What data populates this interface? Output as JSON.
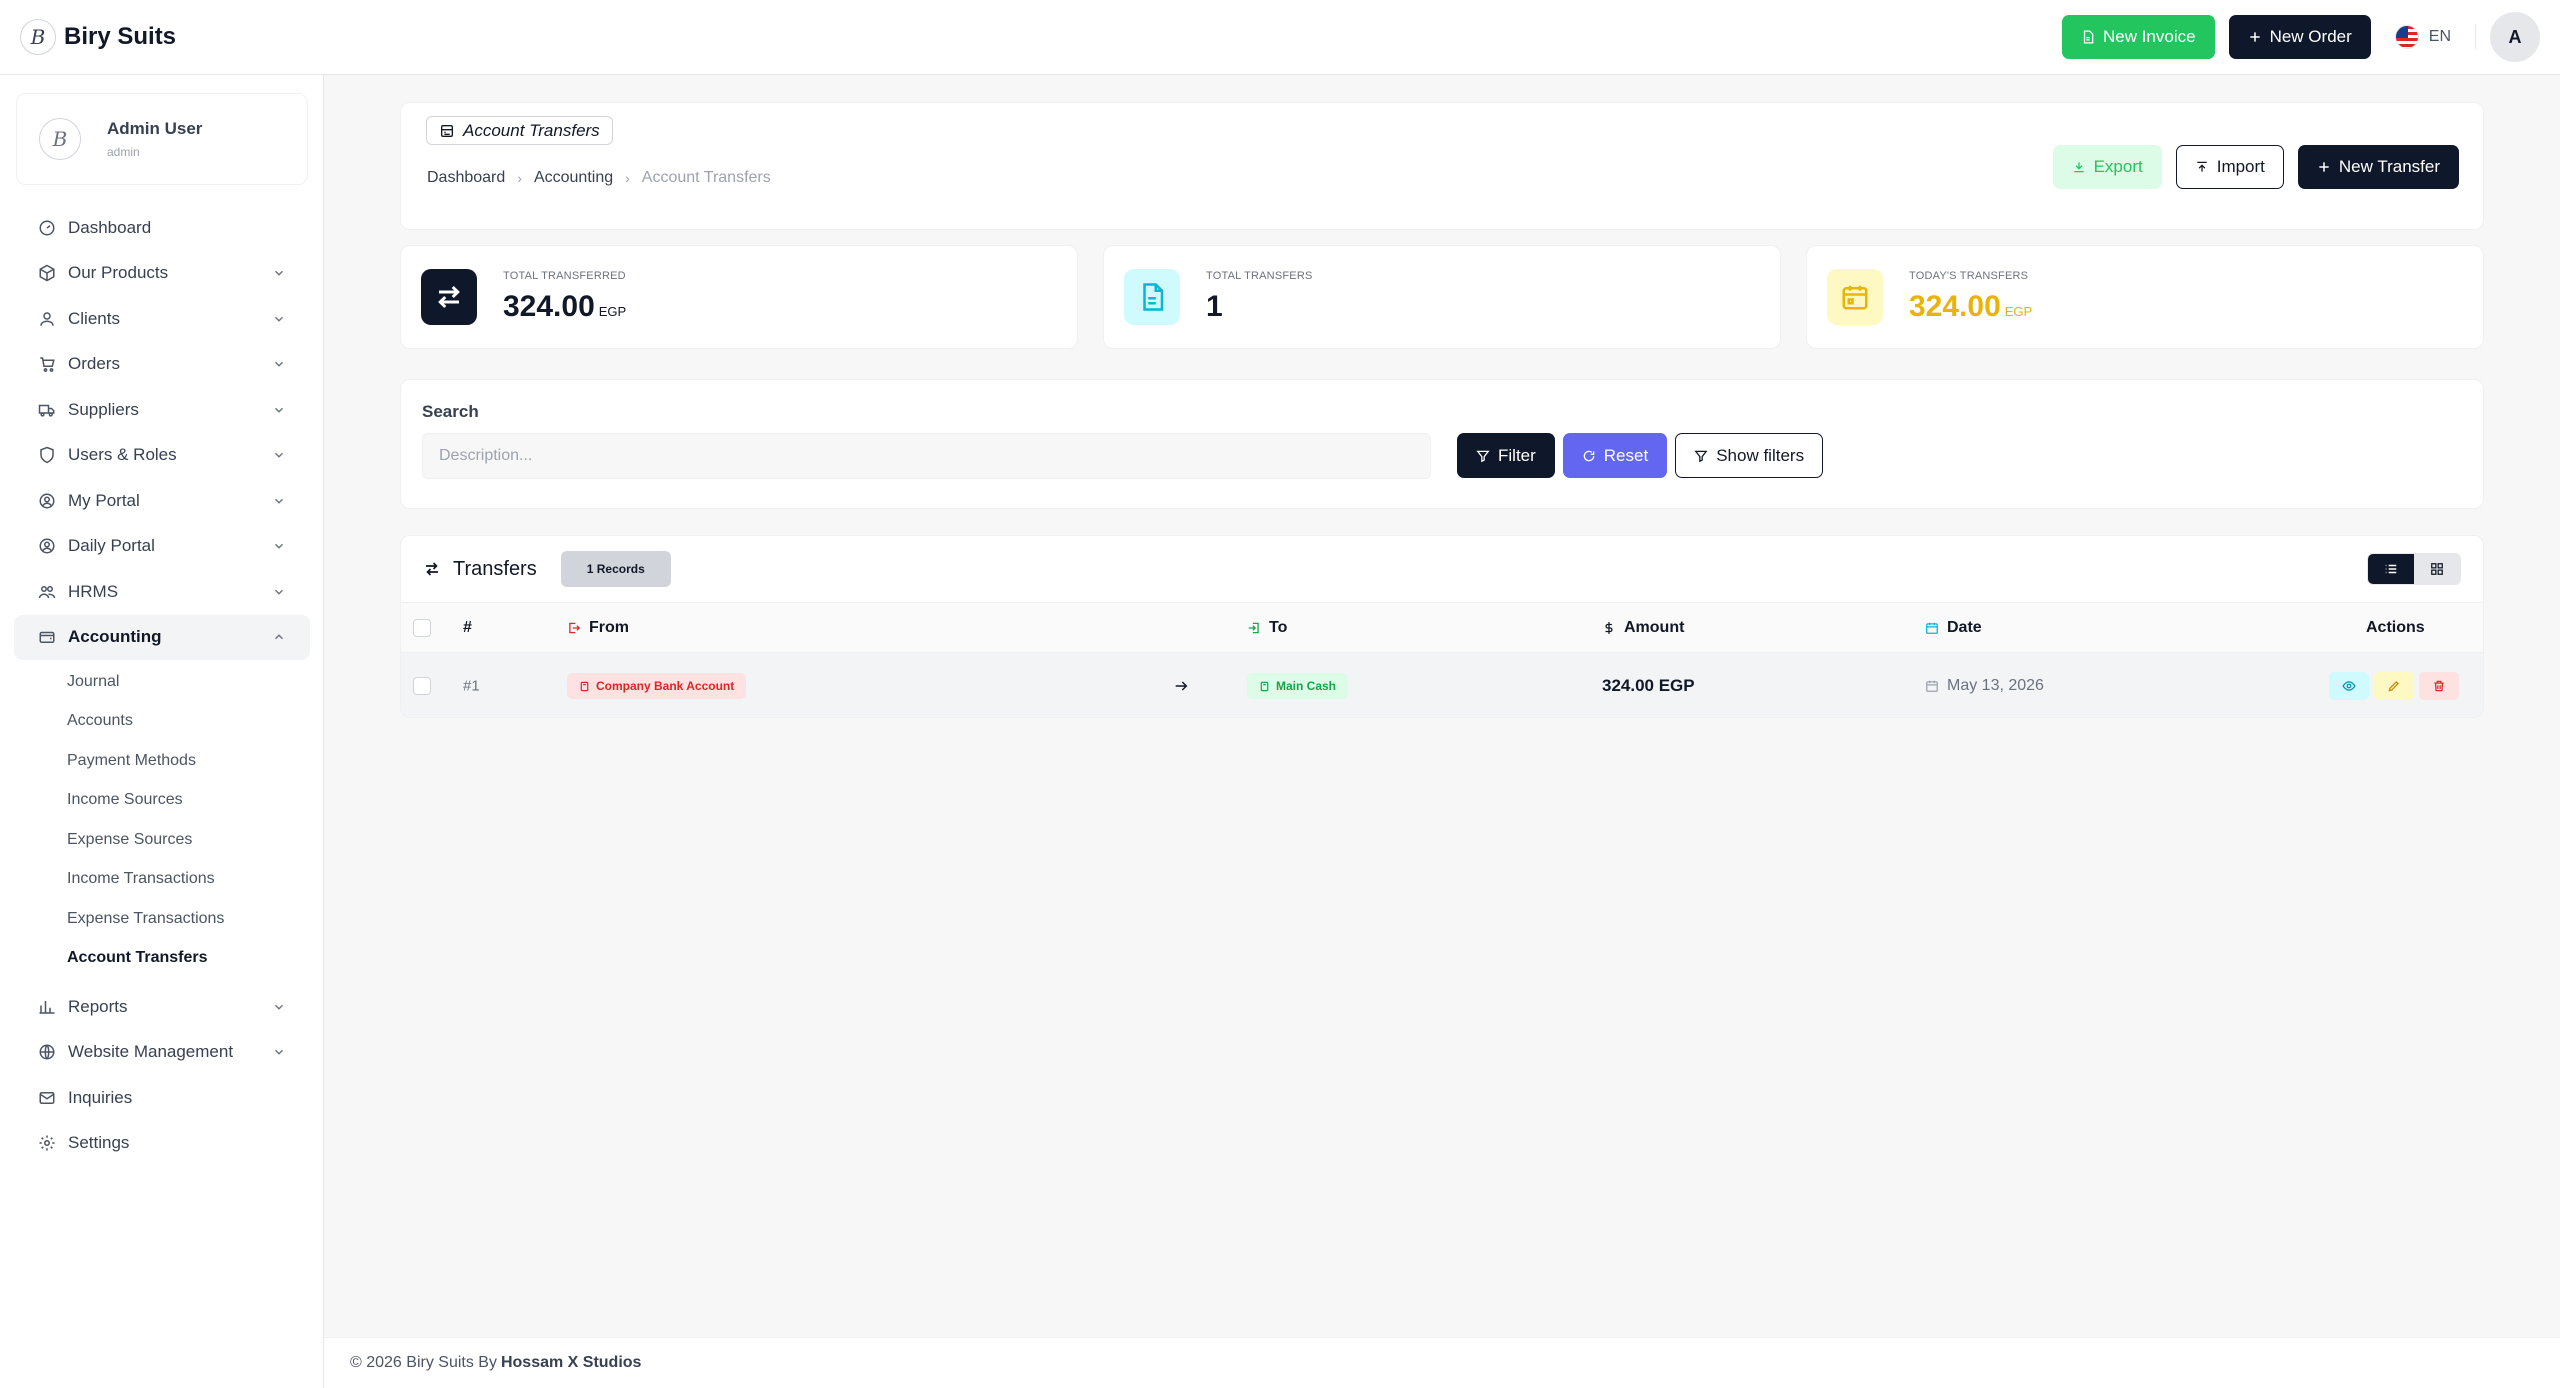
{
  "app": {
    "brand": "Biry Suits",
    "logo_letter": "B"
  },
  "topbar": {
    "new_invoice": "New Invoice",
    "new_order": "New Order",
    "language": "EN",
    "avatar_letter": "A"
  },
  "user": {
    "name": "Admin User",
    "role": "admin"
  },
  "sidebar": {
    "items": [
      {
        "label": "Dashboard"
      },
      {
        "label": "Our Products"
      },
      {
        "label": "Clients"
      },
      {
        "label": "Orders"
      },
      {
        "label": "Suppliers"
      },
      {
        "label": "Users & Roles"
      },
      {
        "label": "My Portal"
      },
      {
        "label": "Daily Portal"
      },
      {
        "label": "HRMS"
      },
      {
        "label": "Accounting"
      },
      {
        "label": "Reports"
      },
      {
        "label": "Website Management"
      },
      {
        "label": "Inquiries"
      },
      {
        "label": "Settings"
      }
    ],
    "accounting_sub": [
      {
        "label": "Journal"
      },
      {
        "label": "Accounts"
      },
      {
        "label": "Payment Methods"
      },
      {
        "label": "Income Sources"
      },
      {
        "label": "Expense Sources"
      },
      {
        "label": "Income Transactions"
      },
      {
        "label": "Expense Transactions"
      },
      {
        "label": "Account Transfers"
      }
    ]
  },
  "page": {
    "title": "Account Transfers",
    "breadcrumb": [
      "Dashboard",
      "Accounting",
      "Account Transfers"
    ],
    "export_label": "Export",
    "import_label": "Import",
    "new_transfer_label": "New Transfer"
  },
  "stats": [
    {
      "label": "Total Transferred",
      "value": "324.00",
      "unit": "EGP",
      "color": "#111827"
    },
    {
      "label": "Total Transfers",
      "value": "1",
      "unit": "",
      "color": "#111827"
    },
    {
      "label": "Today's Transfers",
      "value": "324.00",
      "unit": "EGP",
      "color": "#eab308"
    }
  ],
  "search": {
    "label": "Search",
    "placeholder": "Description...",
    "value": "",
    "filter_label": "Filter",
    "reset_label": "Reset",
    "show_filters_label": "Show filters"
  },
  "table": {
    "title": "Transfers",
    "records_badge": "1 Records",
    "columns": [
      "#",
      "From",
      "To",
      "Amount",
      "Date",
      "Actions"
    ],
    "rows": [
      {
        "id": "#1",
        "from": "Company Bank Account",
        "to": "Main Cash",
        "amount": "324.00 EGP",
        "date": "May 13, 2026"
      }
    ]
  },
  "footer": {
    "text": "© 2026 Biry Suits By",
    "studio": "Hossam X Studios"
  },
  "colors": {
    "green": "#22c55e",
    "dark": "#0f172a",
    "indigo": "#6366f1",
    "yellow": "#eab308"
  }
}
